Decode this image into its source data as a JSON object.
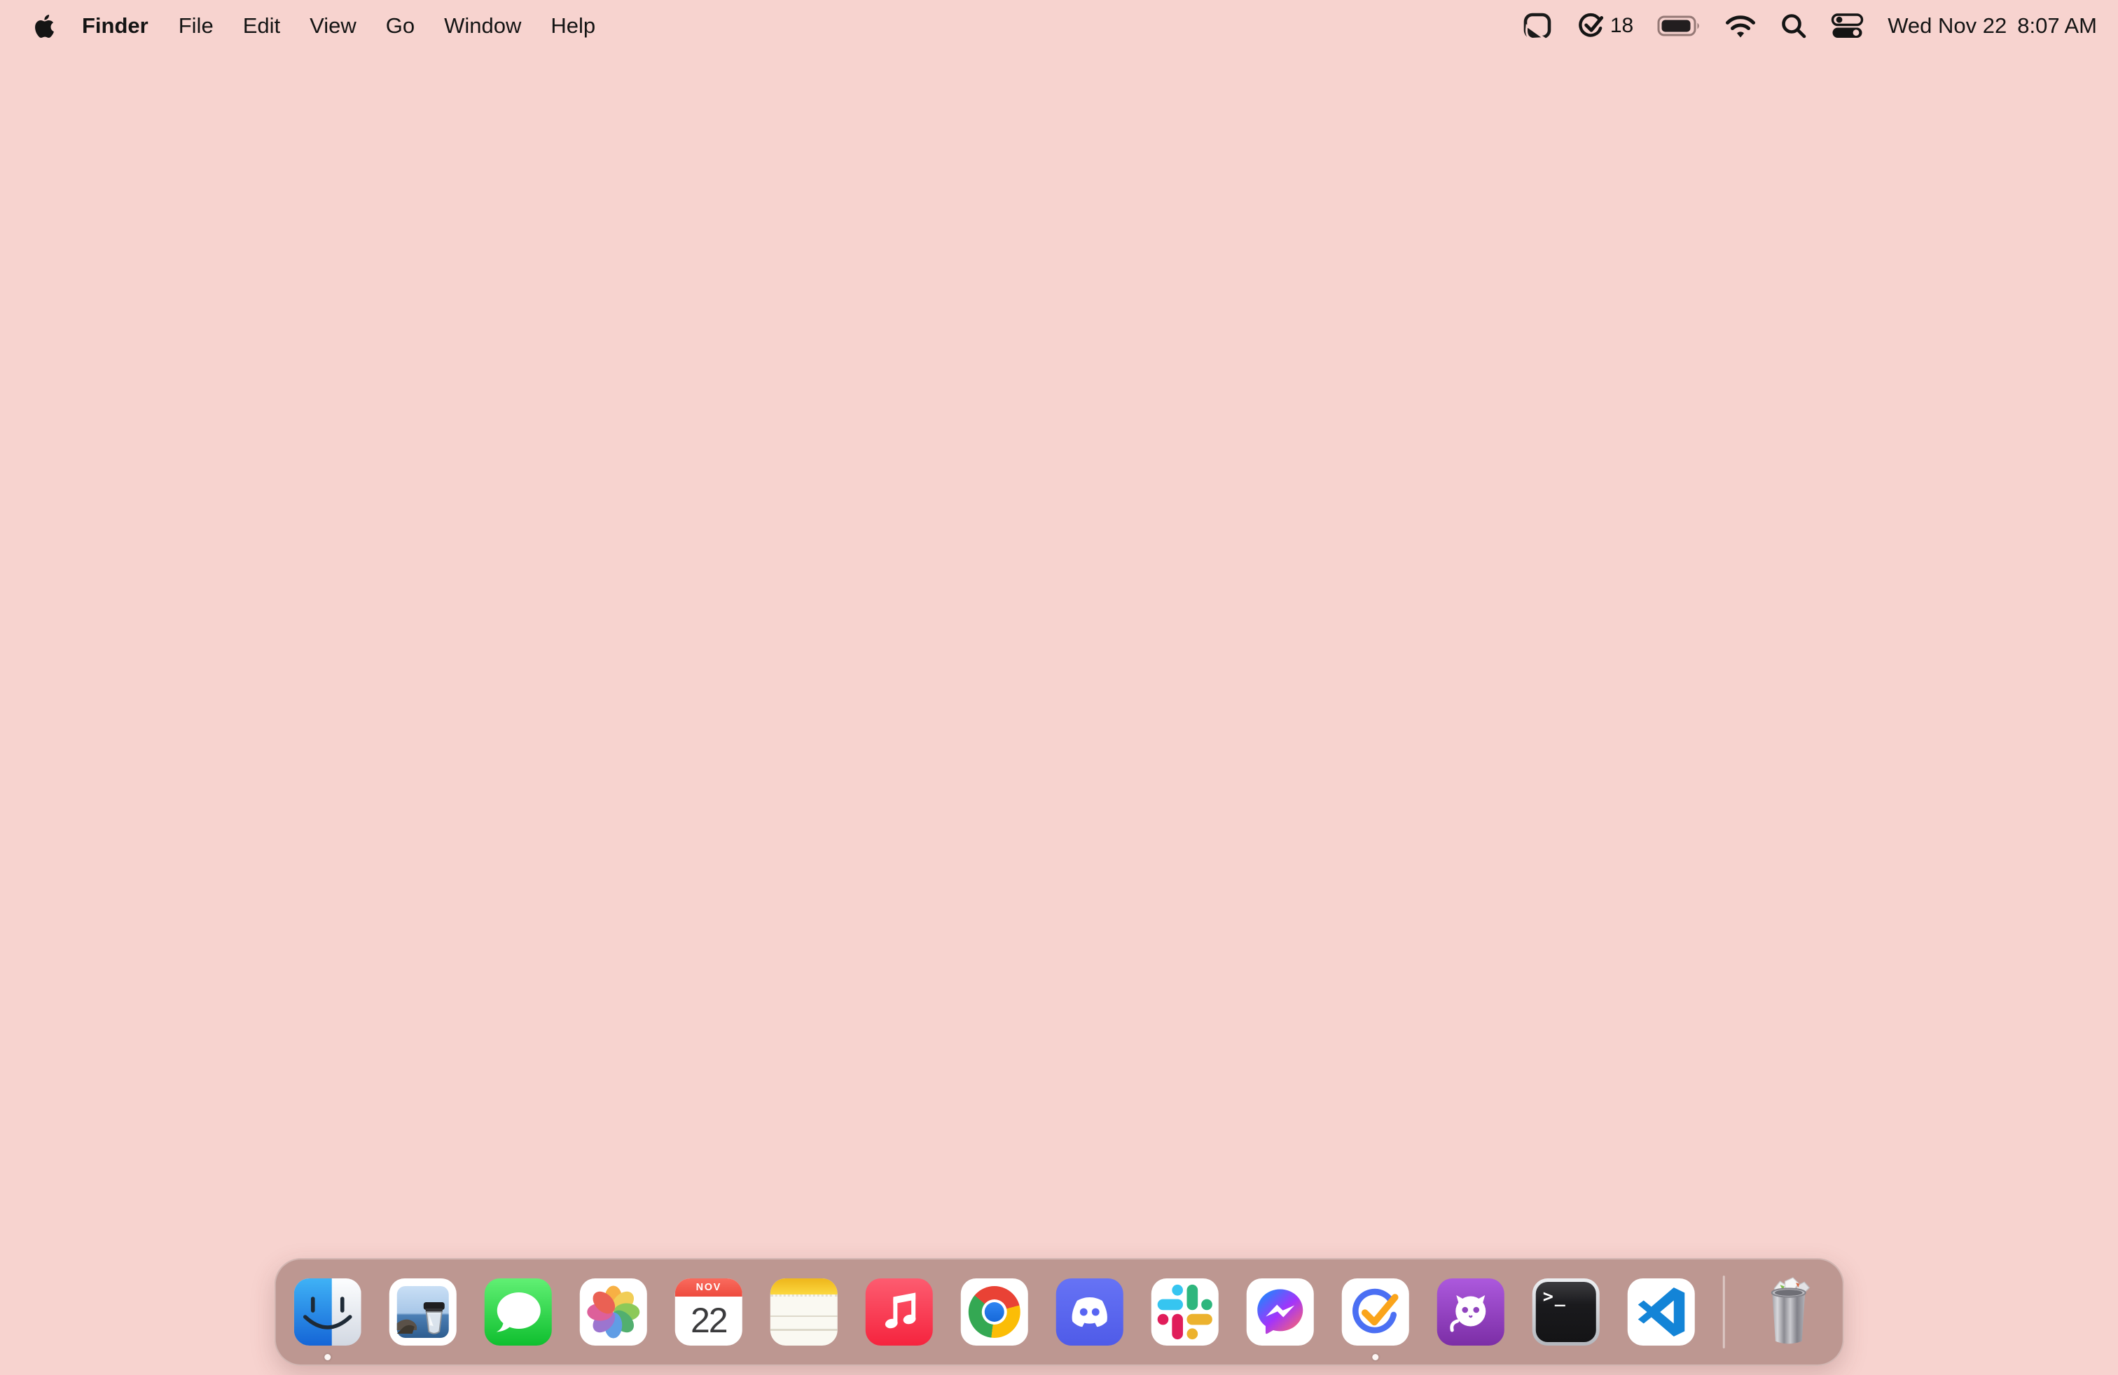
{
  "menubar": {
    "apple_logo": "apple-icon",
    "app_name": "Finder",
    "menus": [
      {
        "label": "File"
      },
      {
        "label": "Edit"
      },
      {
        "label": "View"
      },
      {
        "label": "Go"
      },
      {
        "label": "Window"
      },
      {
        "label": "Help"
      }
    ],
    "status": {
      "extras": [
        "sticker-peel-icon",
        "ticktick-check-icon",
        "battery-icon",
        "wifi-icon",
        "spotlight-search-icon",
        "control-center-icon"
      ],
      "task_count": "18",
      "battery_level": "full",
      "date": "Wed Nov 22",
      "time": "8:07 AM"
    }
  },
  "dock": {
    "apps": [
      {
        "name": "Finder",
        "running": true
      },
      {
        "name": "Preview",
        "running": false
      },
      {
        "name": "Messages",
        "running": false
      },
      {
        "name": "Photos",
        "running": false
      },
      {
        "name": "Calendar",
        "running": false,
        "month": "NOV",
        "day": "22"
      },
      {
        "name": "Notes",
        "running": false
      },
      {
        "name": "Music",
        "running": false
      },
      {
        "name": "Google Chrome",
        "running": false
      },
      {
        "name": "Discord",
        "running": false
      },
      {
        "name": "Slack",
        "running": false
      },
      {
        "name": "Messenger",
        "running": false
      },
      {
        "name": "TickTick",
        "running": true
      },
      {
        "name": "GitHub Desktop",
        "running": false
      },
      {
        "name": "Terminal",
        "running": false,
        "glyph": ">_"
      },
      {
        "name": "Visual Studio Code",
        "running": false
      }
    ],
    "trash": {
      "name": "Trash",
      "state": "full"
    }
  },
  "colors": {
    "wallpaper": "#F7D3CF",
    "dock_background": "rgba(181,142,137,0.88)",
    "finder_blue": "#1668D9",
    "messages_green": "#0FBF2F",
    "music_red": "#F5243E",
    "discord_blurple": "#5865F2",
    "slack": [
      "#36C5F0",
      "#2EB67D",
      "#ECB22E",
      "#E01E5A"
    ],
    "ticktick_blue": "#4B6FF3",
    "ticktick_orange": "#FAA41B",
    "github_purple": "#7C2EA6",
    "vscode_blue": "#1384D7",
    "calendar_red": "#EE4B3E",
    "notes_yellow": "#FCD83F"
  }
}
